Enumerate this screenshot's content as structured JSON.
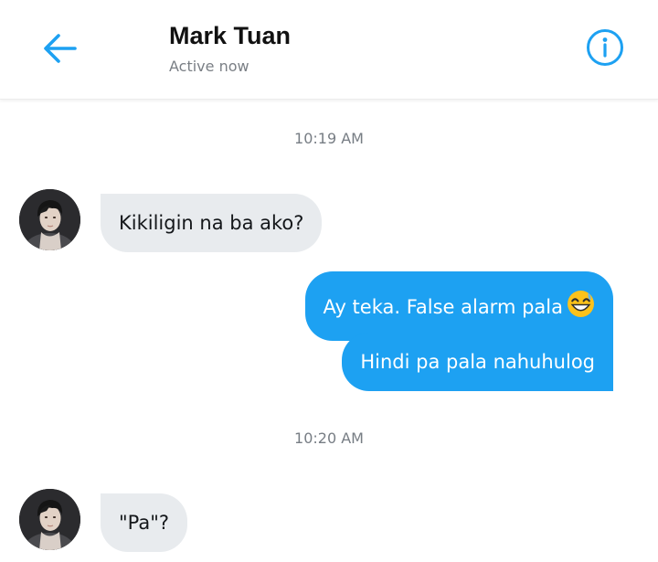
{
  "header": {
    "contact_name": "Mark Tuan",
    "status": "Active now",
    "back_icon": "arrow-left-icon",
    "info_icon": "info-icon"
  },
  "colors": {
    "accent": "#1da1f2",
    "incoming_bubble": "#e8ebee",
    "incoming_text": "#14171a",
    "outgoing_text": "#ffffff",
    "muted_text": "#777d84"
  },
  "conversation": {
    "timestamps": [
      "10:19 AM",
      "10:20 AM"
    ],
    "messages": [
      {
        "direction": "incoming",
        "text": "Kikiligin na ba ako?"
      },
      {
        "direction": "outgoing",
        "text": "Ay teka. False alarm pala",
        "emoji": "grinning-sweat-emoji"
      },
      {
        "direction": "outgoing",
        "text": "Hindi pa pala nahuhulog"
      },
      {
        "direction": "incoming",
        "text": "\"Pa\"?"
      }
    ]
  }
}
